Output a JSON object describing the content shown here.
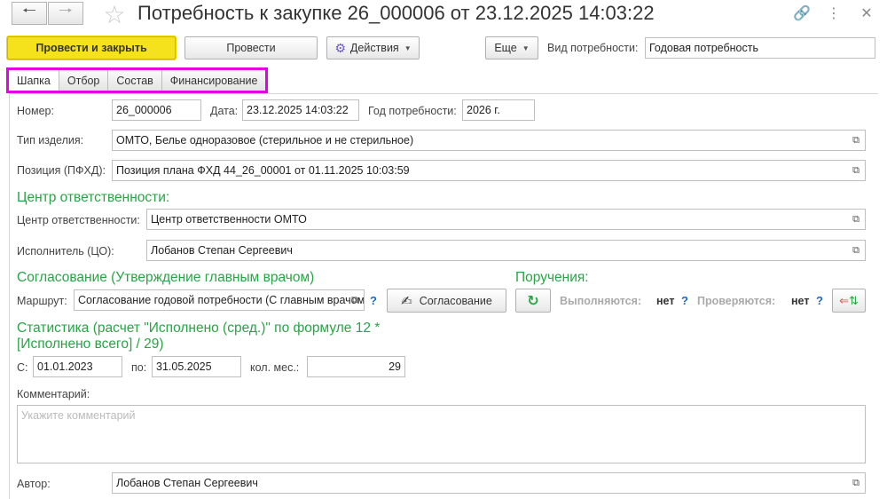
{
  "window": {
    "title": "Потребность к закупке 26_000006 от 23.12.2025 14:03:22"
  },
  "toolbar": {
    "post_close": "Провести и закрыть",
    "post": "Провести",
    "actions": "Действия",
    "more": "Еще",
    "need_type_label": "Вид потребности:",
    "need_type_value": "Годовая потребность"
  },
  "tabs": [
    {
      "label": "Шапка"
    },
    {
      "label": "Отбор"
    },
    {
      "label": "Состав"
    },
    {
      "label": "Финансирование"
    }
  ],
  "form": {
    "number_label": "Номер:",
    "number_value": "26_000006",
    "date_label": "Дата:",
    "date_value": "23.12.2025 14:03:22",
    "year_label": "Год потребности:",
    "year_value": "2026 г.",
    "item_type_label": "Тип изделия:",
    "item_type_value": "ОМТО, Белье одноразовое (стерильное и не стерильное)",
    "position_label": "Позиция (ПФХД):",
    "position_value": "Позиция плана ФХД 44_26_00001 от 01.11.2025 10:03:59"
  },
  "responsibility": {
    "section_title": "Центр ответственности:",
    "center_label": "Центр ответственности:",
    "center_value": "Центр ответственности ОМТО",
    "executor_label": "Исполнитель (ЦО):",
    "executor_value": "Лобанов Степан Сергеевич"
  },
  "approval": {
    "section_title": "Согласование (Утверждение главным врачом)",
    "route_label": "Маршрут:",
    "route_value": "Согласование годовой потребности (С главным врачом)",
    "help": "?",
    "approve_button": "Согласование"
  },
  "orders": {
    "section_title": "Поручения:",
    "executing_label": "Выполняются:",
    "executing_value": "нет",
    "checking_label": "Проверяются:",
    "checking_value": "нет",
    "help": "?"
  },
  "stats": {
    "section_title_line1": "Статистика (расчет \"Исполнено (сред.)\" по формуле 12 *",
    "section_title_line2": "[Исполнено всего] / 29)",
    "from_label": "С:",
    "from_value": "01.01.2023",
    "to_label": "по:",
    "to_value": "31.05.2025",
    "months_label": "кол. мес.:",
    "months_value": "29"
  },
  "comment": {
    "label": "Комментарий:",
    "placeholder": "Укажите комментарий"
  },
  "author": {
    "label": "Автор:",
    "value": "Лобанов Степан Сергеевич"
  }
}
